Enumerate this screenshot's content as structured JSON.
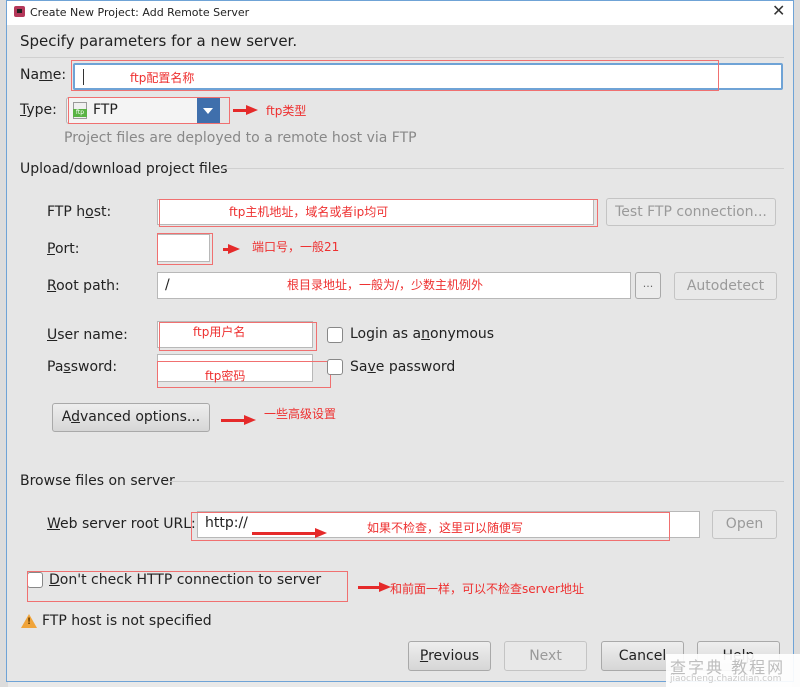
{
  "window": {
    "title": "Create New Project: Add Remote Server",
    "close_icon": "close-icon"
  },
  "heading": "Specify parameters for a new server.",
  "name_field": {
    "label_pre": "Na",
    "label_mn": "m",
    "label_post": "e:",
    "value": ""
  },
  "type_field": {
    "label_mn": "T",
    "label_post": "ype:",
    "selected": "FTP",
    "icon": "ftp-file-icon",
    "description": "Project files are deployed to a remote host via FTP"
  },
  "upload_section": {
    "title": "Upload/download project files",
    "ftp_host": {
      "label_pre": "FTP h",
      "label_mn": "o",
      "label_post": "st:",
      "value": ""
    },
    "test_button": "Test FTP connection...",
    "port": {
      "label_mn": "P",
      "label_post": "ort:",
      "value": ""
    },
    "root_path": {
      "label_mn": "R",
      "label_post": "oot path:",
      "value": "/"
    },
    "browse_button": "...",
    "autodetect_button": "Autodetect",
    "user_name": {
      "label_mn": "U",
      "label_post": "ser name:",
      "value": ""
    },
    "anonymous": {
      "label_pre": "Login as a",
      "label_mn": "n",
      "label_post": "onymous",
      "checked": false
    },
    "password": {
      "label_pre": "Pa",
      "label_mn": "s",
      "label_post": "sword:",
      "value": ""
    },
    "save_password": {
      "label_pre": "Sa",
      "label_mn": "v",
      "label_post": "e password",
      "checked": false
    },
    "advanced_button": {
      "label_pre": "A",
      "label_mn": "d",
      "label_post": "vanced options..."
    }
  },
  "browse_section": {
    "title": "Browse files on server",
    "web_url": {
      "label_mn": "W",
      "label_post": "eb server root URL:",
      "value": "http://"
    },
    "open_button": "Open"
  },
  "dont_check": {
    "label_mn": "D",
    "label_post": "on't check HTTP connection to server",
    "checked": false
  },
  "warning": {
    "icon": "warning-icon",
    "text": "FTP host is not specified"
  },
  "footer": {
    "previous": {
      "label_mn": "P",
      "label_post": "revious"
    },
    "next": "Next",
    "cancel": "Cancel",
    "help": "Help"
  },
  "annotations": {
    "name": "ftp配置名称",
    "type": "ftp类型",
    "host": "ftp主机地址，域名或者ip均可",
    "port": "端口号，一般21",
    "root": "根目录地址，一般为/，少数主机例外",
    "user": "ftp用户名",
    "password": "ftp密码",
    "advanced": "一些高级设置",
    "web_url": "如果不检查，这里可以随便写",
    "dont_check": "和前面一样，可以不检查server地址"
  },
  "watermark": {
    "line1": "查字典 教程网",
    "line2": "jiaocheng.chazidian.com"
  },
  "colors": {
    "accent": "#3f6fac",
    "annotation": "#ee3030",
    "focus": "#6fa3d6",
    "warning": "#f0a43a"
  }
}
